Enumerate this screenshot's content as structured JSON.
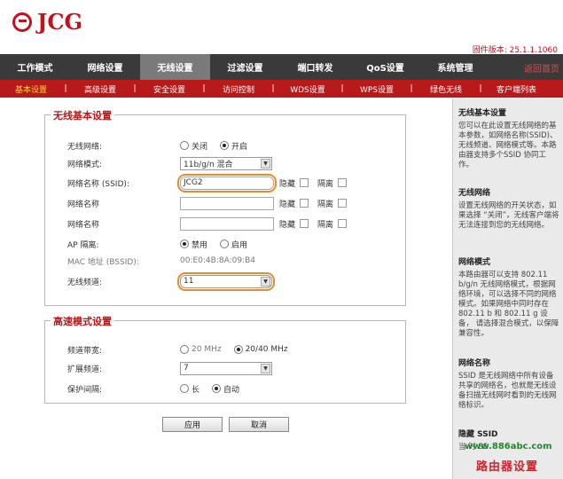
{
  "brand": {
    "logo_text": "JCG",
    "brand_color": "#c1121f"
  },
  "firmware": "固件版本: 25.1.1.1060",
  "main_nav": {
    "items": [
      "工作模式",
      "网络设置",
      "无线设置",
      "过滤设置",
      "端口转发",
      "QoS设置",
      "系统管理"
    ],
    "active_index": 2,
    "home_link": "返回首页"
  },
  "sub_nav": {
    "items": [
      "基本设置",
      "高级设置",
      "安全设置",
      "访问控制",
      "WDS设置",
      "WPS设置",
      "绿色无线",
      "客户端列表"
    ],
    "active_index": 0
  },
  "wireless_basic": {
    "title": "无线基本设置",
    "wireless_network": {
      "label": "无线网络:",
      "opt_off": "关闭",
      "opt_on": "开启",
      "selected": "开启"
    },
    "network_mode": {
      "label": "网络模式:",
      "value": "11b/g/n 混合"
    },
    "ssid_main": {
      "label": "网络名称 (SSID):",
      "value": "JCG2",
      "hide_label": "隐藏",
      "isolate_label": "隔离"
    },
    "ssid2": {
      "label": "网络名称",
      "value": "",
      "hide_label": "隐藏",
      "isolate_label": "隔离"
    },
    "ssid3": {
      "label": "网络名称",
      "value": "",
      "hide_label": "隐藏",
      "isolate_label": "隔离"
    },
    "ap_isolation": {
      "label": "AP 隔离:",
      "opt_disable": "禁用",
      "opt_enable": "启用",
      "selected": "禁用"
    },
    "mac": {
      "label": "MAC 地址 (BSSID):",
      "value": "00:E0:4B:8A:09:B4"
    },
    "channel": {
      "label": "无线频道:",
      "value": "11"
    }
  },
  "ht_mode": {
    "title": "高速模式设置",
    "bandwidth": {
      "label": "频道带宽:",
      "opt_20": "20 MHz",
      "opt_2040": "20/40 MHz",
      "selected": "20/40 MHz"
    },
    "ext_channel": {
      "label": "扩展频道:",
      "value": "7"
    },
    "guard_interval": {
      "label": "保护间隔:",
      "opt_long": "长",
      "opt_auto": "自动",
      "selected": "自动"
    }
  },
  "buttons": {
    "apply": "应用",
    "cancel": "取消"
  },
  "help": [
    {
      "title": "无线基本设置",
      "text": "您可以在此设置无线网络的基本参数，如网络名称(SSID)、无线频道、网络模式等。本路由器支持多个SSID 协同工作。"
    },
    {
      "title": "无线网络",
      "text": "设置无线网络的开关状态，如果选择 “关闭”，无线客户端将无法连接到您的无线网络。"
    },
    {
      "title": "网络模式",
      "text": "本路由器可以支持 802.11 b/g/n 无线网络模式，根据网络环境，可以选择不同的网络模式。如果网络中同时存在 802.11 b 和 802.11 g 设备， 请选择混合模式，以保障兼容性。"
    },
    {
      "title": "网络名称",
      "text": "SSID 是无线网络中所有设备共享的网络名，也就是无线设备扫描无线网时看到的无线网络标识。"
    },
    {
      "title": "隐藏 SSID",
      "text": "当 时 SS"
    }
  ],
  "watermark": {
    "url": "www.886abc.com",
    "title": "路由器设置"
  },
  "colors": {
    "accent": "#b8191b",
    "nav_bg": "#3a3a3a",
    "highlight": "#e58c2f",
    "help_bg": "#eaeaea"
  }
}
